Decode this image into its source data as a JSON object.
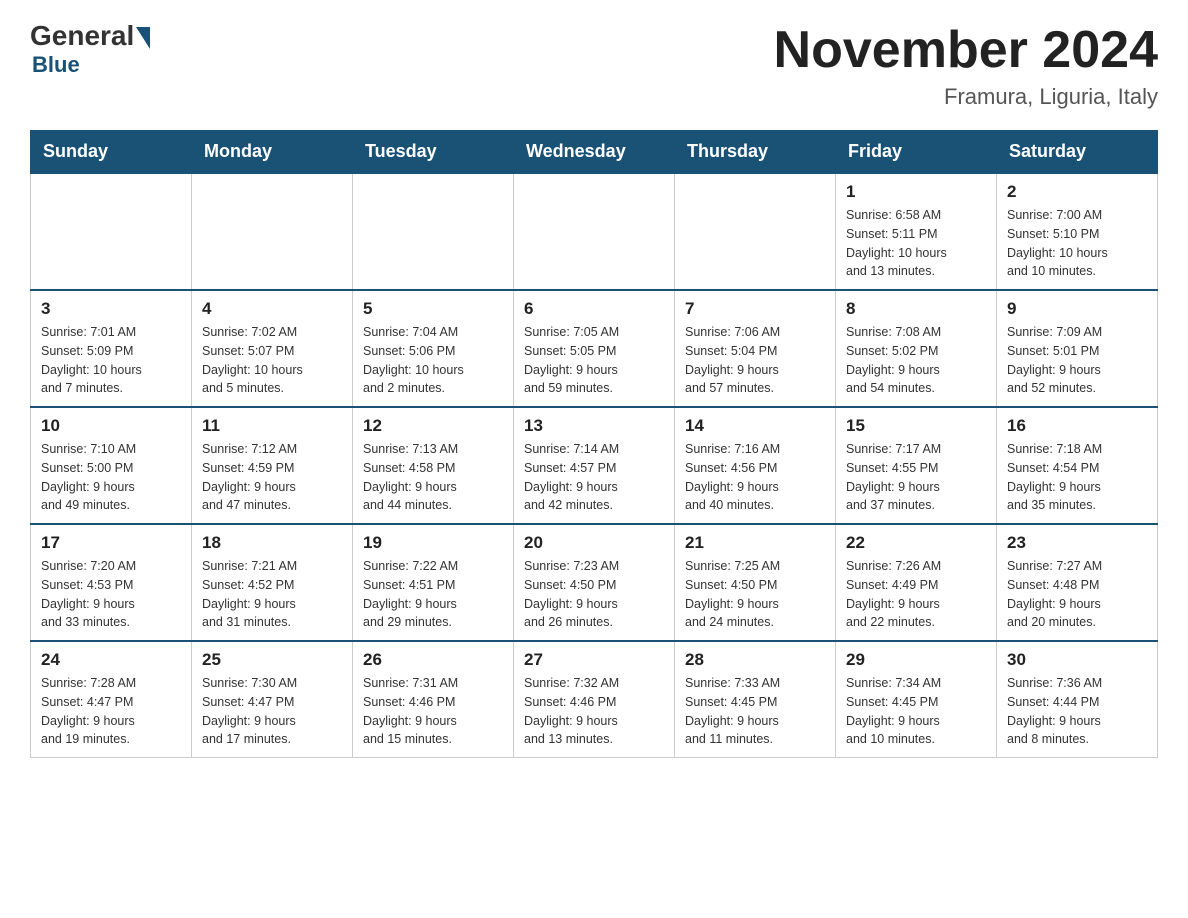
{
  "logo": {
    "general": "General",
    "blue": "Blue"
  },
  "title": "November 2024",
  "location": "Framura, Liguria, Italy",
  "days_of_week": [
    "Sunday",
    "Monday",
    "Tuesday",
    "Wednesday",
    "Thursday",
    "Friday",
    "Saturday"
  ],
  "weeks": [
    [
      {
        "day": "",
        "info": ""
      },
      {
        "day": "",
        "info": ""
      },
      {
        "day": "",
        "info": ""
      },
      {
        "day": "",
        "info": ""
      },
      {
        "day": "",
        "info": ""
      },
      {
        "day": "1",
        "info": "Sunrise: 6:58 AM\nSunset: 5:11 PM\nDaylight: 10 hours\nand 13 minutes."
      },
      {
        "day": "2",
        "info": "Sunrise: 7:00 AM\nSunset: 5:10 PM\nDaylight: 10 hours\nand 10 minutes."
      }
    ],
    [
      {
        "day": "3",
        "info": "Sunrise: 7:01 AM\nSunset: 5:09 PM\nDaylight: 10 hours\nand 7 minutes."
      },
      {
        "day": "4",
        "info": "Sunrise: 7:02 AM\nSunset: 5:07 PM\nDaylight: 10 hours\nand 5 minutes."
      },
      {
        "day": "5",
        "info": "Sunrise: 7:04 AM\nSunset: 5:06 PM\nDaylight: 10 hours\nand 2 minutes."
      },
      {
        "day": "6",
        "info": "Sunrise: 7:05 AM\nSunset: 5:05 PM\nDaylight: 9 hours\nand 59 minutes."
      },
      {
        "day": "7",
        "info": "Sunrise: 7:06 AM\nSunset: 5:04 PM\nDaylight: 9 hours\nand 57 minutes."
      },
      {
        "day": "8",
        "info": "Sunrise: 7:08 AM\nSunset: 5:02 PM\nDaylight: 9 hours\nand 54 minutes."
      },
      {
        "day": "9",
        "info": "Sunrise: 7:09 AM\nSunset: 5:01 PM\nDaylight: 9 hours\nand 52 minutes."
      }
    ],
    [
      {
        "day": "10",
        "info": "Sunrise: 7:10 AM\nSunset: 5:00 PM\nDaylight: 9 hours\nand 49 minutes."
      },
      {
        "day": "11",
        "info": "Sunrise: 7:12 AM\nSunset: 4:59 PM\nDaylight: 9 hours\nand 47 minutes."
      },
      {
        "day": "12",
        "info": "Sunrise: 7:13 AM\nSunset: 4:58 PM\nDaylight: 9 hours\nand 44 minutes."
      },
      {
        "day": "13",
        "info": "Sunrise: 7:14 AM\nSunset: 4:57 PM\nDaylight: 9 hours\nand 42 minutes."
      },
      {
        "day": "14",
        "info": "Sunrise: 7:16 AM\nSunset: 4:56 PM\nDaylight: 9 hours\nand 40 minutes."
      },
      {
        "day": "15",
        "info": "Sunrise: 7:17 AM\nSunset: 4:55 PM\nDaylight: 9 hours\nand 37 minutes."
      },
      {
        "day": "16",
        "info": "Sunrise: 7:18 AM\nSunset: 4:54 PM\nDaylight: 9 hours\nand 35 minutes."
      }
    ],
    [
      {
        "day": "17",
        "info": "Sunrise: 7:20 AM\nSunset: 4:53 PM\nDaylight: 9 hours\nand 33 minutes."
      },
      {
        "day": "18",
        "info": "Sunrise: 7:21 AM\nSunset: 4:52 PM\nDaylight: 9 hours\nand 31 minutes."
      },
      {
        "day": "19",
        "info": "Sunrise: 7:22 AM\nSunset: 4:51 PM\nDaylight: 9 hours\nand 29 minutes."
      },
      {
        "day": "20",
        "info": "Sunrise: 7:23 AM\nSunset: 4:50 PM\nDaylight: 9 hours\nand 26 minutes."
      },
      {
        "day": "21",
        "info": "Sunrise: 7:25 AM\nSunset: 4:50 PM\nDaylight: 9 hours\nand 24 minutes."
      },
      {
        "day": "22",
        "info": "Sunrise: 7:26 AM\nSunset: 4:49 PM\nDaylight: 9 hours\nand 22 minutes."
      },
      {
        "day": "23",
        "info": "Sunrise: 7:27 AM\nSunset: 4:48 PM\nDaylight: 9 hours\nand 20 minutes."
      }
    ],
    [
      {
        "day": "24",
        "info": "Sunrise: 7:28 AM\nSunset: 4:47 PM\nDaylight: 9 hours\nand 19 minutes."
      },
      {
        "day": "25",
        "info": "Sunrise: 7:30 AM\nSunset: 4:47 PM\nDaylight: 9 hours\nand 17 minutes."
      },
      {
        "day": "26",
        "info": "Sunrise: 7:31 AM\nSunset: 4:46 PM\nDaylight: 9 hours\nand 15 minutes."
      },
      {
        "day": "27",
        "info": "Sunrise: 7:32 AM\nSunset: 4:46 PM\nDaylight: 9 hours\nand 13 minutes."
      },
      {
        "day": "28",
        "info": "Sunrise: 7:33 AM\nSunset: 4:45 PM\nDaylight: 9 hours\nand 11 minutes."
      },
      {
        "day": "29",
        "info": "Sunrise: 7:34 AM\nSunset: 4:45 PM\nDaylight: 9 hours\nand 10 minutes."
      },
      {
        "day": "30",
        "info": "Sunrise: 7:36 AM\nSunset: 4:44 PM\nDaylight: 9 hours\nand 8 minutes."
      }
    ]
  ]
}
